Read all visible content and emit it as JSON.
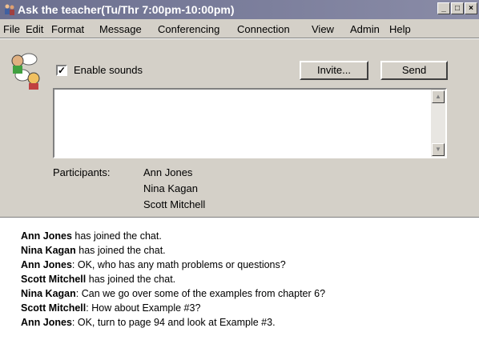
{
  "window": {
    "title": "Ask the teacher(Tu/Thr 7:00pm-10:00pm)",
    "minimize": "_",
    "maximize": "□",
    "close": "×"
  },
  "menu": [
    "File",
    "Edit",
    "Format",
    "Message",
    "Conferencing",
    "Connection",
    "View",
    "Admin",
    "Help"
  ],
  "toolbar": {
    "enable_sounds_label": "Enable sounds",
    "enable_sounds_checked": true,
    "check_mark": "✓",
    "invite_label": "Invite...",
    "send_label": "Send"
  },
  "message_input": {
    "value": ""
  },
  "participants": {
    "label": "Participants:",
    "names": [
      "Ann Jones",
      "Nina Kagan",
      "Scott Mitchell"
    ]
  },
  "chat_log": [
    {
      "speaker": "Ann Jones",
      "text": " has joined the chat."
    },
    {
      "speaker": "Nina Kagan",
      "text": " has joined the chat."
    },
    {
      "speaker": "Ann Jones",
      "text": ": OK, who has any math problems or questions?"
    },
    {
      "speaker": "Scott Mitchell",
      "text": " has joined the chat."
    },
    {
      "speaker": "Nina Kagan",
      "text": ": Can we go over some of the examples from chapter 6?"
    },
    {
      "speaker": "Scott Mitchell",
      "text": ": How about Example #3?"
    },
    {
      "speaker": "Ann Jones",
      "text": ": OK, turn to page 94 and look at Example #3."
    }
  ],
  "colors": {
    "titlebar": "#6b6f8f",
    "chrome": "#d4d0c8"
  },
  "icons": {
    "app": "chat-people-icon",
    "toolbar": "chat-speech-bubbles-icon"
  }
}
